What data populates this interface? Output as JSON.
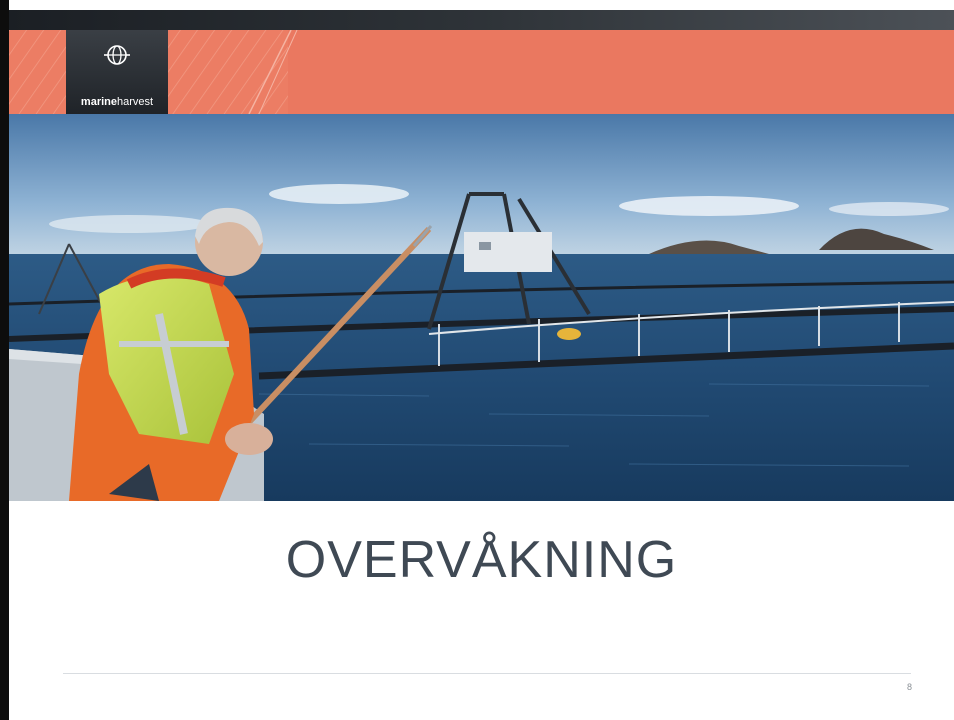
{
  "header": {
    "logo": {
      "icon": "globe-icon",
      "brand_bold": "marine",
      "brand_regular": "harvest"
    }
  },
  "photo": {
    "subject": "photo"
  },
  "slide": {
    "title": "OVERVÅKNING",
    "page_number": "8"
  },
  "colors": {
    "banner": "#ea7860",
    "top_bar": "#2e3338",
    "logo_box": "#2b3036",
    "title": "#3f4954"
  }
}
